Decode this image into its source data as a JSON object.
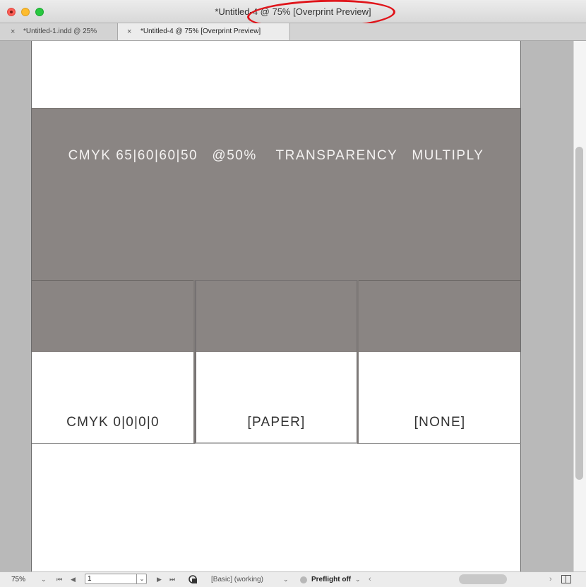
{
  "window": {
    "title": "*Untitled-4 @ 75% [Overprint Preview]"
  },
  "tabs": [
    {
      "close": "×",
      "label": "*Untitled-1.indd @ 25%"
    },
    {
      "close": "×",
      "label": "*Untitled-4 @ 75% [Overprint Preview]"
    }
  ],
  "document": {
    "band_label": "CMYK 65|60|60|50   @50%    TRANSPARENCY   MULTIPLY",
    "band_color": "#8a8583",
    "frames": [
      {
        "label": "CMYK 0|0|0|0"
      },
      {
        "label": "[PAPER]"
      },
      {
        "label": "[NONE]"
      }
    ]
  },
  "statusbar": {
    "zoom": "75%",
    "page_number": "1",
    "profile": "[Basic] (working)",
    "preflight": "Preflight off",
    "icons": {
      "chevron": "⌄",
      "first": "⏮",
      "prev": "◀",
      "next": "▶",
      "last": "⏭",
      "scroll_left": "‹",
      "scroll_right": "›"
    }
  }
}
